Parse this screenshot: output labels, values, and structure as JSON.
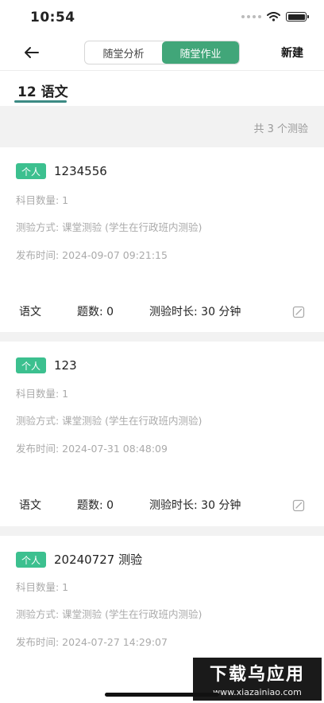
{
  "status": {
    "time": "10:54"
  },
  "nav": {
    "tabs": [
      {
        "label": "随堂分析",
        "active": false
      },
      {
        "label": "随堂作业",
        "active": true
      }
    ],
    "new_label": "新建"
  },
  "subject_tab": {
    "label": "12 语文"
  },
  "summary": {
    "text": "共 3 个测验"
  },
  "cards": [
    {
      "tag": "个人",
      "title": "1234556",
      "subject_count": "科目数量: 1",
      "method": "测验方式: 课堂测验 (学生在行政班内测验)",
      "publish_time": "发布时间: 2024-09-07 09:21:15",
      "subject": "语文",
      "question_count": "题数: 0",
      "duration": "测验时长: 30 分钟"
    },
    {
      "tag": "个人",
      "title": "123",
      "subject_count": "科目数量: 1",
      "method": "测验方式: 课堂测验 (学生在行政班内测验)",
      "publish_time": "发布时间: 2024-07-31 08:48:09",
      "subject": "语文",
      "question_count": "题数: 0",
      "duration": "测验时长: 30 分钟"
    },
    {
      "tag": "个人",
      "title": "20240727 测验",
      "subject_count": "科目数量: 1",
      "method": "测验方式: 课堂测验 (学生在行政班内测验)",
      "publish_time": "发布时间: 2024-07-27 14:29:07"
    }
  ],
  "watermark": {
    "big": "下载乌应用",
    "small": "www.xiazainiao.com"
  },
  "colors": {
    "accent": "#41a679",
    "tag": "#3cc08f",
    "underline": "#3c8a84"
  },
  "icons": [
    "back-arrow-icon",
    "wifi-icon",
    "battery-icon",
    "edit-icon"
  ]
}
